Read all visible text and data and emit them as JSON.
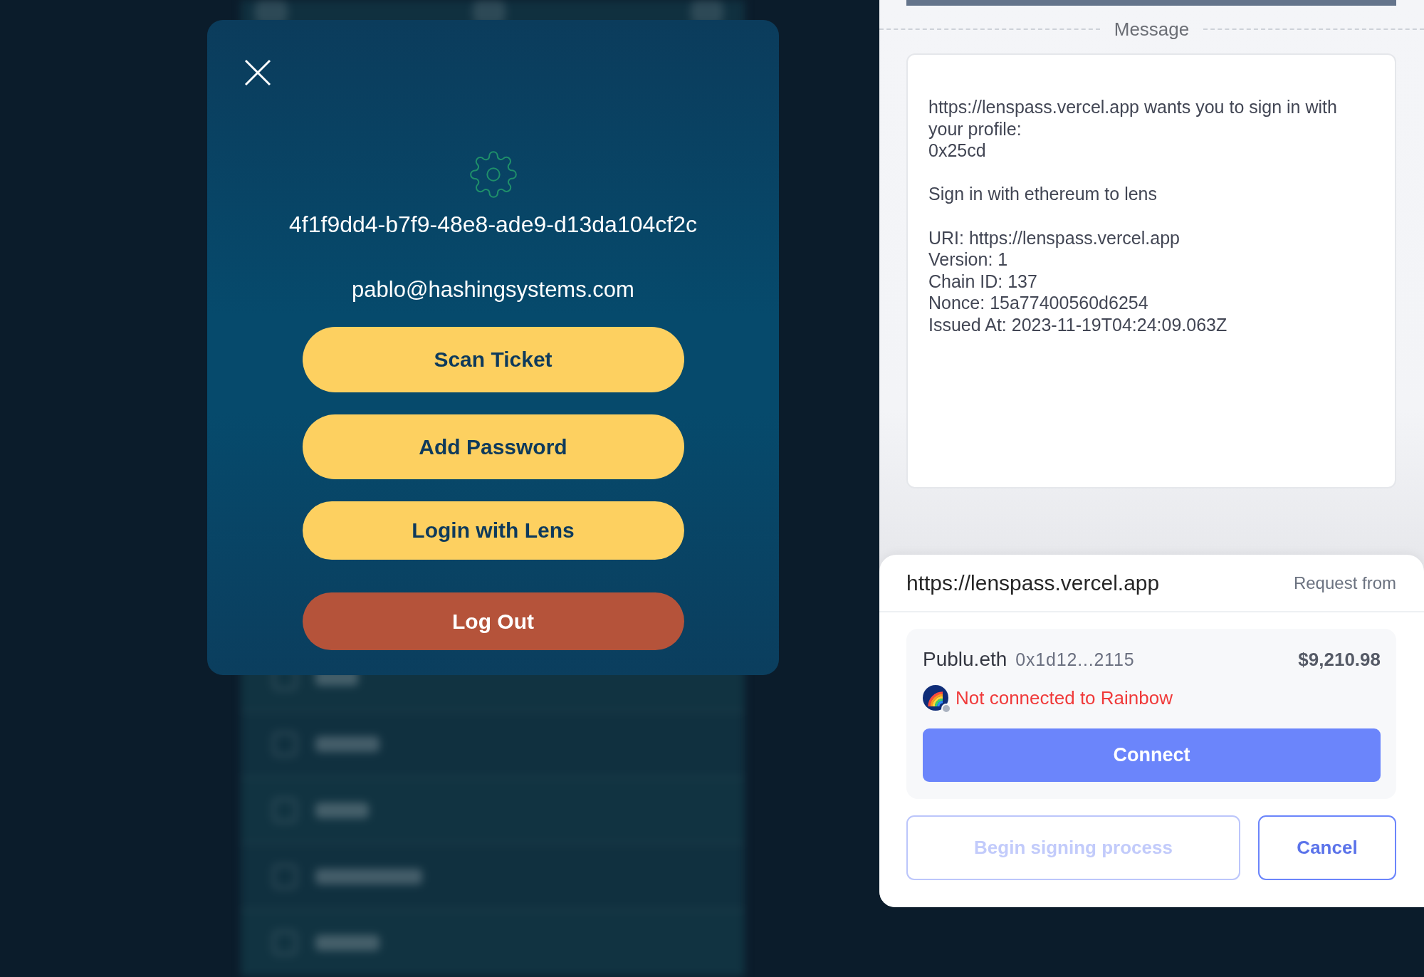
{
  "modal": {
    "uuid": "4f1f9dd4-b7f9-48e8-ade9-d13da104cf2c",
    "email": "pablo@hashingsystems.com",
    "buttons": [
      {
        "label": "Scan Ticket",
        "kind": "primary"
      },
      {
        "label": "Add Password",
        "kind": "primary"
      },
      {
        "label": "Login with Lens",
        "kind": "primary"
      },
      {
        "label": "Log Out",
        "kind": "danger"
      }
    ]
  },
  "signature_request": {
    "message_title": "Message",
    "message": "https://lenspass.vercel.app wants you to sign in with your profile:\n0x25cd\n\nSign in with ethereum to lens\n\nURI: https://lenspass.vercel.app\nVersion: 1\nChain ID: 137\nNonce: 15a77400560d6254\nIssued At: 2023-11-19T04:24:09.063Z"
  },
  "request_sheet": {
    "origin": "https://lenspass.vercel.app",
    "origin_label": "Request from",
    "account": {
      "name": "Publu.eth",
      "address": "0x1d12...2115",
      "balance": "$9,210.98",
      "connected": false,
      "status": "Not connected to Rainbow"
    },
    "connect_button": {
      "label": "Connect"
    },
    "actions": [
      {
        "label": "Begin signing process",
        "disabled": true
      },
      {
        "label": "Cancel",
        "disabled": false
      }
    ]
  }
}
